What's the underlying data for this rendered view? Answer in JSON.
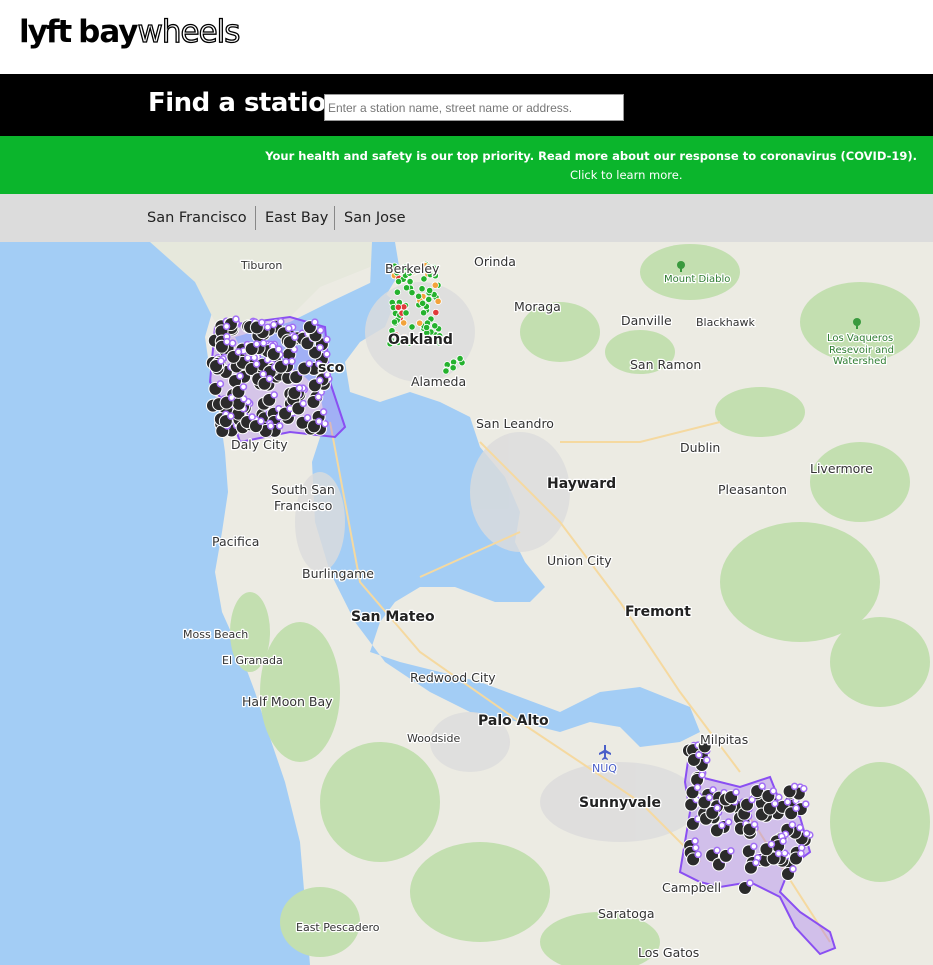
{
  "brand": {
    "logo_lyft": "lyft",
    "logo_bay": "bay",
    "logo_wheels": "wheels"
  },
  "search": {
    "title": "Find a station",
    "placeholder": "Enter a station name, street name or address."
  },
  "banner": {
    "headline": "Your health and safety is our top priority. Read more about our response to coronavirus (COVID-19).",
    "cta": "Click to learn more.",
    "color": "#0bb52c"
  },
  "tabs": [
    "San Francisco",
    "East Bay",
    "San Jose"
  ],
  "map": {
    "labels": {
      "tiburon": "Tiburon",
      "berkeley": "Berkeley",
      "orinda": "Orinda",
      "mount_diablo": "Mount Diablo",
      "moraga": "Moraga",
      "danville": "Danville",
      "blackhawk": "Blackhawk",
      "los_vaqueros": "Los Vaqueros",
      "reservoir_and": "Resevoir and",
      "watershed": "Watershed",
      "francisco_frag": "sco",
      "oakland": "Oakland",
      "alameda": "Alameda",
      "san_ramon": "San Ramon",
      "san_leandro": "San Leandro",
      "daly_city": "Daly City",
      "dublin": "Dublin",
      "livermore": "Livermore",
      "hayward": "Hayward",
      "south_sf_1": "South San",
      "south_sf_2": "Francisco",
      "pleasanton": "Pleasanton",
      "pacifica": "Pacifica",
      "union_city": "Union City",
      "burlingame": "Burlingame",
      "fremont": "Fremont",
      "san_mateo": "San Mateo",
      "moss_beach": "Moss Beach",
      "el_granada": "El Granada",
      "redwood_city": "Redwood City",
      "half_moon_bay": "Half Moon Bay",
      "palo_alto": "Palo Alto",
      "woodside": "Woodside",
      "milpitas": "Milpitas",
      "nuq": "NUQ",
      "sunnyvale": "Sunnyvale",
      "campbell": "Campbell",
      "saratoga": "Saratoga",
      "east_pescadero": "East Pescadero",
      "los_gatos": "Los Gatos"
    },
    "colors": {
      "water": "#a3cdf5",
      "land": "#ecebe3",
      "park": "#c3dfb0",
      "urban": "#dfdfdf",
      "service_area": "#8a4ff2",
      "station_dock": "#2b2b2b",
      "station_ring": "#a26ef5",
      "ebike_station": "#25b22e"
    }
  }
}
